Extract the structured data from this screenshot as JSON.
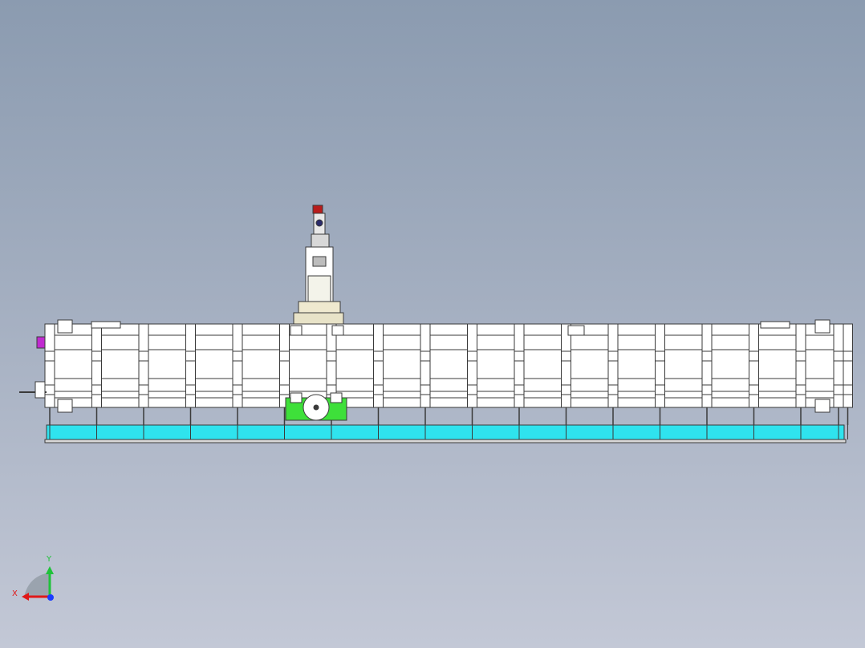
{
  "triad": {
    "x_label": "X",
    "y_label": "Y"
  },
  "colors": {
    "background_top": "#8b9bb0",
    "background_bottom": "#c3c8d6",
    "frame_fill": "#ffffff",
    "frame_stroke": "#3a3a3a",
    "rail": "#2fe3ee",
    "drive_unit": "#3ee03a",
    "axis_x": "#e01818",
    "axis_y": "#1fc23a",
    "axis_z": "#1a3cff",
    "connector": "#c02ad0"
  }
}
